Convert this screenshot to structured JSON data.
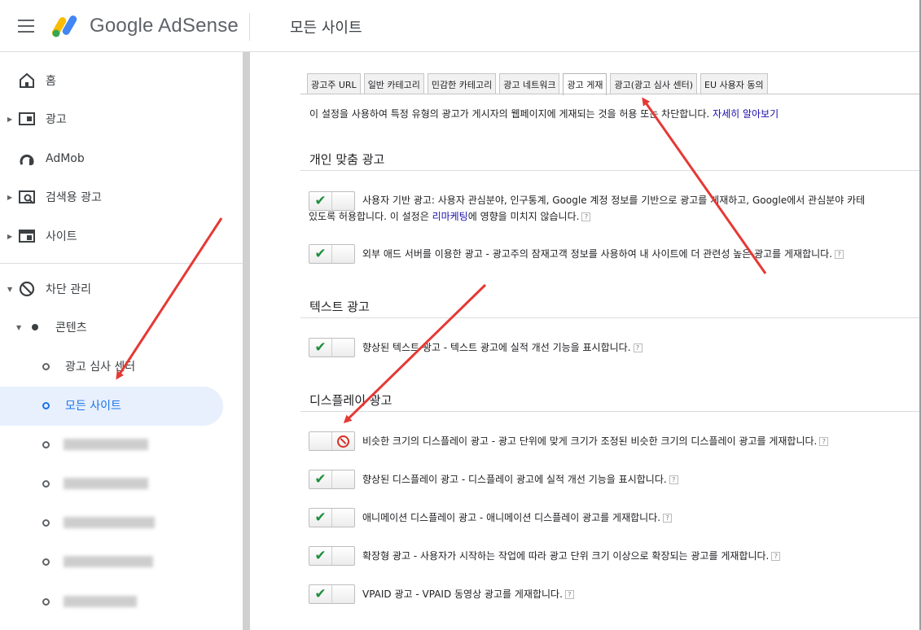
{
  "header": {
    "brand": "Google AdSense",
    "page_title": "모든 사이트",
    "menu_icon": "hamburger-menu-icon",
    "logo_colors": [
      "#fbbc04",
      "#34a853",
      "#4285f4"
    ]
  },
  "sidebar": {
    "items": [
      {
        "label": "홈",
        "icon": "home-icon"
      },
      {
        "label": "광고",
        "icon": "ads-icon"
      },
      {
        "label": "AdMob",
        "icon": "admob-icon"
      },
      {
        "label": "검색용 광고",
        "icon": "search-ads-icon"
      },
      {
        "label": "사이트",
        "icon": "sites-icon"
      },
      {
        "label": "차단 관리",
        "icon": "block-icon"
      }
    ],
    "content_group": "콘텐츠",
    "sub_items": [
      {
        "label": "광고 심사 센터"
      },
      {
        "label": "모든 사이트",
        "active": true
      }
    ],
    "active_color": "#1a73e8"
  },
  "main": {
    "tabs": [
      "광고주 URL",
      "일반 카테고리",
      "민감한 카테고리",
      "광고 네트워크",
      "광고 게재",
      "광고(광고 심사 센터)",
      "EU 사용자 동의"
    ],
    "active_tab": "광고 게재",
    "description": "이 설정을 사용하여 특정 유형의 광고가 게시자의 웹페이지에 게재되는 것을 허용 또는 차단합니다.",
    "learn_more": "자세히 알아보기",
    "sections": {
      "personalized": {
        "title": "개인 맞춤 광고",
        "opt1_line1": "사용자 기반 광고: 사용자 관심분야, 인구통계, Google 계정 정보를 기반으로 광고를 게재하고, Google에서 관심분야 카테",
        "opt1_line2_pre": "있도록 허용합니다. 이 설정은 ",
        "opt1_link": "리마케팅",
        "opt1_line2_post": "에 영향을 미치지 않습니다.",
        "opt2": "외부 애드 서버를 이용한 광고 - 광고주의 잠재고객 정보를 사용하여 내 사이트에 더 관련성 높은 광고를 게재합니다."
      },
      "text": {
        "title": "텍스트 광고",
        "opt1": "향상된 텍스트 광고 - 텍스트 광고에 실적 개선 기능을 표시합니다."
      },
      "display": {
        "title": "디스플레이 광고",
        "opt1": "비슷한 크기의 디스플레이 광고 - 광고 단위에 맞게 크기가 조정된 비슷한 크기의 디스플레이 광고를 게재합니다.",
        "opt2": "향상된 디스플레이 광고 - 디스플레이 광고에 실적 개선 기능을 표시합니다.",
        "opt3": "애니메이션 디스플레이 광고 - 애니메이션 디스플레이 광고를 게재합니다.",
        "opt4": "확장형 광고 - 사용자가 시작하는 작업에 따라 광고 단위 크기 이상으로 확장되는 광고를 게재합니다.",
        "opt5": "VPAID 광고 - VPAID 동영상 광고를 게재합니다."
      }
    },
    "toggle_states": {
      "personalized_opt1": "on",
      "personalized_opt2": "on",
      "text_opt1": "on",
      "display_opt1": "off",
      "display_opt2": "on",
      "display_opt3": "on",
      "display_opt4": "on",
      "display_opt5": "on"
    },
    "help_glyph": "?",
    "annotation_arrow_color": "#e53935"
  }
}
